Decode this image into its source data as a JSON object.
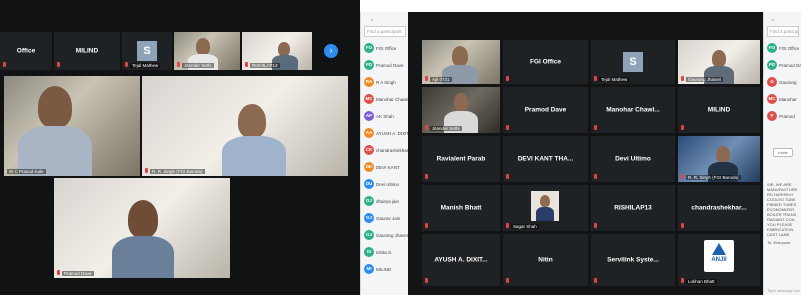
{
  "shot1": {
    "top_strip": [
      {
        "name": "Office"
      },
      {
        "name": "MILIND"
      },
      {
        "avatar_letter": "S",
        "label": "Tejal Mathew"
      },
      {
        "label": "Jitender Sethi"
      },
      {
        "label": "RISHILAP13"
      }
    ],
    "main": [
      {
        "label": "W C Prasad Kale"
      },
      {
        "label": "R. R. Singh (FGI Baroda)"
      },
      {
        "label": "Pramod Dave"
      }
    ]
  },
  "panel1": {
    "search_placeholder": "Find a participant",
    "participants": [
      {
        "initials": "FO",
        "color": "#2fb08a",
        "name": "FGI Office"
      },
      {
        "initials": "PD",
        "color": "#2fb08a",
        "name": "Pramod Dave"
      },
      {
        "initials": "RA",
        "color": "#f08a24",
        "name": "R A Singh"
      },
      {
        "initials": "MC",
        "color": "#e0504a",
        "name": "Manohar Chawla"
      },
      {
        "initials": "AP",
        "color": "#7c5cd6",
        "name": "AK Shah"
      },
      {
        "initials": "AA",
        "color": "#f08a24",
        "name": "AYUSH A. DIXIT"
      },
      {
        "initials": "CK",
        "color": "#e0504a",
        "name": "chandrashekhar"
      },
      {
        "initials": "DK",
        "color": "#f08a24",
        "name": "DEVI KANT"
      },
      {
        "initials": "DU",
        "color": "#2d8cf0",
        "name": "Devi Ultimo"
      },
      {
        "initials": "DJ",
        "color": "#2fb08a",
        "name": "dhairya jain"
      },
      {
        "initials": "GJ",
        "color": "#2d8cf0",
        "name": "Gaurav Jain"
      },
      {
        "initials": "GJ",
        "color": "#2fb08a",
        "name": "Gaurang Jhaveri"
      },
      {
        "initials": "IS",
        "color": "#2fb08a",
        "name": "Ishita S."
      },
      {
        "initials": "MI",
        "color": "#2d8cf0",
        "name": "MILIND"
      }
    ]
  },
  "shot2": {
    "grid": [
      {
        "label": "Ajit 0731",
        "video": true
      },
      {
        "name": "FGI Office"
      },
      {
        "avatar_letter": "S",
        "label": "Tejal Mathew"
      },
      {
        "label": "Gaurang Jhaveri",
        "video": true
      },
      {
        "label": "Jitender Sethi",
        "video": true
      },
      {
        "name": "Pramod Dave"
      },
      {
        "name": "Manohar Chawl..."
      },
      {
        "name": "MILIND"
      },
      {
        "name": "Ravialent Parab"
      },
      {
        "name": "DEVI KANT THA..."
      },
      {
        "name": "Devi Ultimo"
      },
      {
        "label": "R. R. Singh (FGI Baroda)",
        "video": true
      },
      {
        "name": "Manish Bhatt"
      },
      {
        "label": "Sagar Shah",
        "video": true
      },
      {
        "name": "RISHILAP13"
      },
      {
        "name": "chandrashekhar..."
      },
      {
        "name": "AYUSH A. DIXIT..."
      },
      {
        "name": "Nitin"
      },
      {
        "name": "Servilink Syste..."
      },
      {
        "label": "Lokhan Bhatt",
        "logo": "ANJII"
      }
    ]
  },
  "panel2": {
    "search_placeholder": "Find a participant",
    "participants": [
      {
        "initials": "FO",
        "color": "#2fb08a",
        "name": "FGI Office"
      },
      {
        "initials": "PD",
        "color": "#2fb08a",
        "name": "Pramod Dave"
      },
      {
        "initials": "G",
        "color": "#e0504a",
        "name": "Gaurang"
      },
      {
        "initials": "MC",
        "color": "#e0504a",
        "name": "Manohar"
      },
      {
        "initials": "P",
        "color": "#e0504a",
        "name": "Pramod"
      }
    ],
    "invite_label": "Invite",
    "chat": [
      "SIR, WE ARE",
      "MANUFACTURE",
      "RD HARISIKH",
      "COOLED TUBE",
      "FINNED TUBES",
      "ECONOMIZER",
      "BOILER TRANS",
      "RADIANT COIL",
      "YOU PLEASE",
      "FABRICATION",
      "CAST LAME"
    ],
    "chat_to": "To: Everyone",
    "type_placeholder": "Type message here..."
  }
}
